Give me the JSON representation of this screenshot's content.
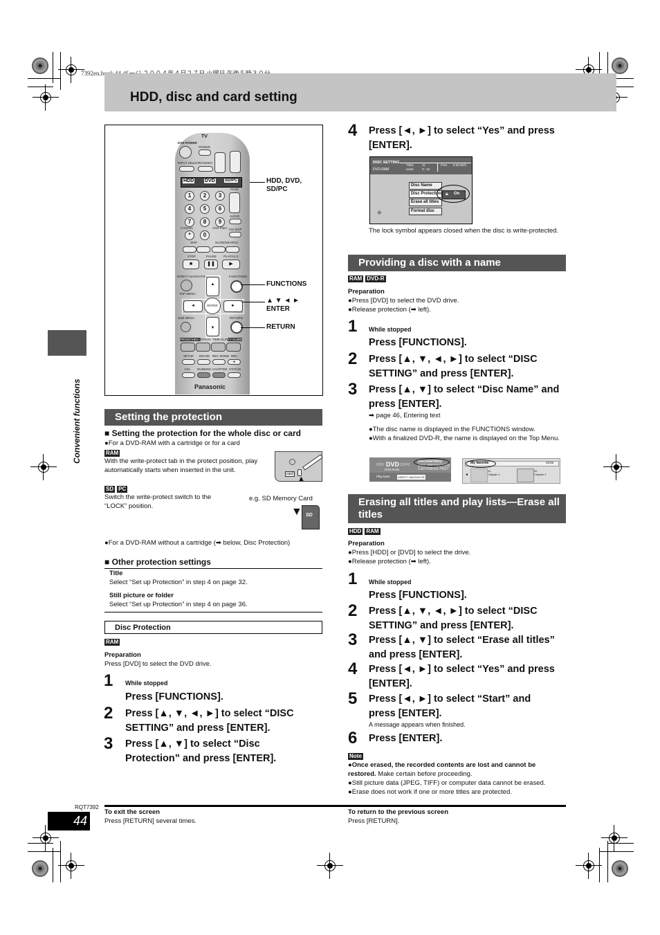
{
  "print_header": "7392en.book  44 ページ  ２００４年４月２７日  火曜日  午後５時３０分",
  "page_title": "HDD, disc and card setting",
  "side_label": "Convenient functions",
  "remote": {
    "labels": {
      "dvd_power": "DVD POWER",
      "tv": "TV",
      "power": "POWER",
      "input_select": "INPUT SELECT",
      "tv_video": "TV/VIDEO",
      "ch": "CH",
      "volume": "VOLUME",
      "hdd": "HDD",
      "dvd": "DVD",
      "sdpc": "SD/PC",
      "page": "PAGE",
      "audio": "AUDIO",
      "cancel": "CANCEL",
      "vcr_plus": "VCR Plus+",
      "cm_skip": "CM SKIP",
      "skip": "SKIP",
      "slow_search": "SLOW/SEARCH",
      "stop": "STOP",
      "pause": "PAUSE",
      "play": "PLAY/x1.3",
      "direct_navigator": "DIRECT NAVIGATOR",
      "top_menu": "TOP MENU",
      "functions": "FUNCTIONS",
      "enter": "ENTER",
      "sub_menu": "SUB MENU",
      "return": "RETURN",
      "prog_check": "PROG/CHECK",
      "display": "DISPLAY",
      "time_slip": "TIME SLIP",
      "tv_guide": "TV GUIDE",
      "setup": "SETUP",
      "erase": "ERASE",
      "rec_mode": "REC MODE",
      "rec": "REC",
      "info": "Info",
      "dubbing": "DUBBING",
      "chapter": "CHAPTER",
      "status": "STATUS",
      "brand": "Panasonic"
    },
    "numbers": [
      "1",
      "2",
      "3",
      "4",
      "5",
      "6",
      "7",
      "8",
      "9",
      "*",
      "0"
    ],
    "callouts": {
      "drive": "HDD, DVD,\nSD/PC",
      "functions": "FUNCTIONS",
      "arrows": "▲ ▼ ◄ ►",
      "enter": "ENTER",
      "return": "RETURN"
    }
  },
  "left": {
    "section_title": "Setting the protection",
    "whole_disc_heading": "■ Setting the protection for the whole disc or card",
    "whole_disc_bullet": "●For a DVD-RAM with a cartridge or for a card",
    "ram_badge": "RAM",
    "ram_text": "With the write-protect tab in the protect position, play automatically starts when inserted in the unit.",
    "sd_badge": "SD",
    "pc_badge": "PC",
    "sd_text": "Switch the write-protect switch to the “LOCK” position.",
    "sd_caption": "e.g. SD Memory Card",
    "cartridge_label": "card",
    "sd_logo": "SD",
    "no_cartridge_bullet": "●For a DVD-RAM without a cartridge (➡ below, Disc Protection)",
    "other_heading": "■ Other protection settings",
    "other_items": [
      {
        "title": "Title",
        "text": "Select “Set up Protection” in step 4 on page 32."
      },
      {
        "title": "Still picture or folder",
        "text": "Select “Set up Protection” in step 4 on page 36."
      }
    ],
    "disc_protection_heading": "Disc Protection",
    "disc_protection_badge": "RAM",
    "preparation_label": "Preparation",
    "preparation_text": "Press [DVD] to select the DVD drive.",
    "steps": [
      {
        "num": "1",
        "pre": "While stopped",
        "text": "Press [FUNCTIONS]."
      },
      {
        "num": "2",
        "text": "Press [▲, ▼, ◄, ►] to select “DISC SETTING” and press [ENTER]."
      },
      {
        "num": "3",
        "text": "Press [▲, ▼] to select “Disc Protection” and press [ENTER]."
      }
    ]
  },
  "right": {
    "step4": {
      "num": "4",
      "text": "Press [◄, ►] to select “Yes” and press [ENTER]."
    },
    "disc_setting_screen": {
      "title": "DISC SETTING",
      "disc": "DVD-RAM",
      "titles_label": "Titles",
      "titles_value": "11",
      "used_label": "Used",
      "used_value": "0 : 22",
      "free_label": "Free",
      "free_value": "5:38 (EP)",
      "menu": [
        "Disc Name",
        "Disc Protection",
        "Erase all titles",
        "Format disc"
      ],
      "option": "On"
    },
    "lock_caption": "The lock symbol appears closed when the disc is write-protected.",
    "naming": {
      "section_title": "Providing a disc with a name",
      "badges": [
        "RAM",
        "DVD-R"
      ],
      "preparation_label": "Preparation",
      "preparation": [
        "●Press [DVD] to select the DVD drive.",
        "●Release protection (➡ left)."
      ],
      "steps": [
        {
          "num": "1",
          "pre": "While stopped",
          "text": "Press [FUNCTIONS]."
        },
        {
          "num": "2",
          "text": "Press [▲, ▼, ◄, ►] to select “DISC SETTING” and press [ENTER]."
        },
        {
          "num": "3",
          "text": "Press [▲, ▼] to select “Disc Name” and press [ENTER]."
        }
      ],
      "ref": "➡ page 46, Entering text",
      "notes": [
        "●The disc name is displayed in the FUNCTIONS window.",
        "●With a finalized DVD-R, the name is displayed on the Top Menu."
      ],
      "functions_screen": {
        "hdd": "HDD",
        "dvd": "DVD",
        "sdpc": "SD/PC",
        "disc": "DVD-RAM",
        "name": "Documentary",
        "line1": "DISC PROTECTION",
        "line2": "CARTRIDGE PROT",
        "play_back": "Play back",
        "direct_nav": "DIRECT NAVIGATOR"
      },
      "top_menu_screen": {
        "name": "My favorite",
        "page": "01/02",
        "chapter1_num": "01",
        "chapter1": "Chapter 1",
        "chapter2_num": "02",
        "chapter2": "Chapter 2"
      }
    },
    "erasing": {
      "section_title": "Erasing all titles and play lists—Erase all titles",
      "badges": [
        "HDD",
        "RAM"
      ],
      "preparation_label": "Preparation",
      "preparation": [
        "●Press [HDD] or [DVD] to select the drive.",
        "●Release protection (➡ left)."
      ],
      "steps": [
        {
          "num": "1",
          "pre": "While stopped",
          "text": "Press [FUNCTIONS]."
        },
        {
          "num": "2",
          "text": "Press [▲, ▼, ◄, ►] to select “DISC SETTING” and press [ENTER]."
        },
        {
          "num": "3",
          "text": "Press [▲, ▼] to select “Erase all titles” and press [ENTER]."
        },
        {
          "num": "4",
          "text": "Press [◄, ►] to select “Yes” and press [ENTER]."
        },
        {
          "num": "5",
          "text": "Press [◄, ►] to select “Start” and press [ENTER].",
          "post": "A message appears when finished."
        },
        {
          "num": "6",
          "text": "Press [ENTER]."
        }
      ],
      "note_label": "Note",
      "notes": [
        {
          "bold": "●Once erased, the recorded contents are lost and cannot be restored.",
          "rest": " Make certain before proceeding."
        },
        {
          "bold": "",
          "rest": "●Still picture data (JPEG, TIFF) or computer data cannot be erased."
        },
        {
          "bold": "",
          "rest": "●Erase does not work if one or more titles are protected."
        }
      ]
    }
  },
  "footer": {
    "doc_code": "RQT7392",
    "page_number": "44",
    "exit_title": "To exit the screen",
    "exit_text": "Press [RETURN] several times.",
    "return_title": "To return to the previous screen",
    "return_text": "Press [RETURN]."
  }
}
